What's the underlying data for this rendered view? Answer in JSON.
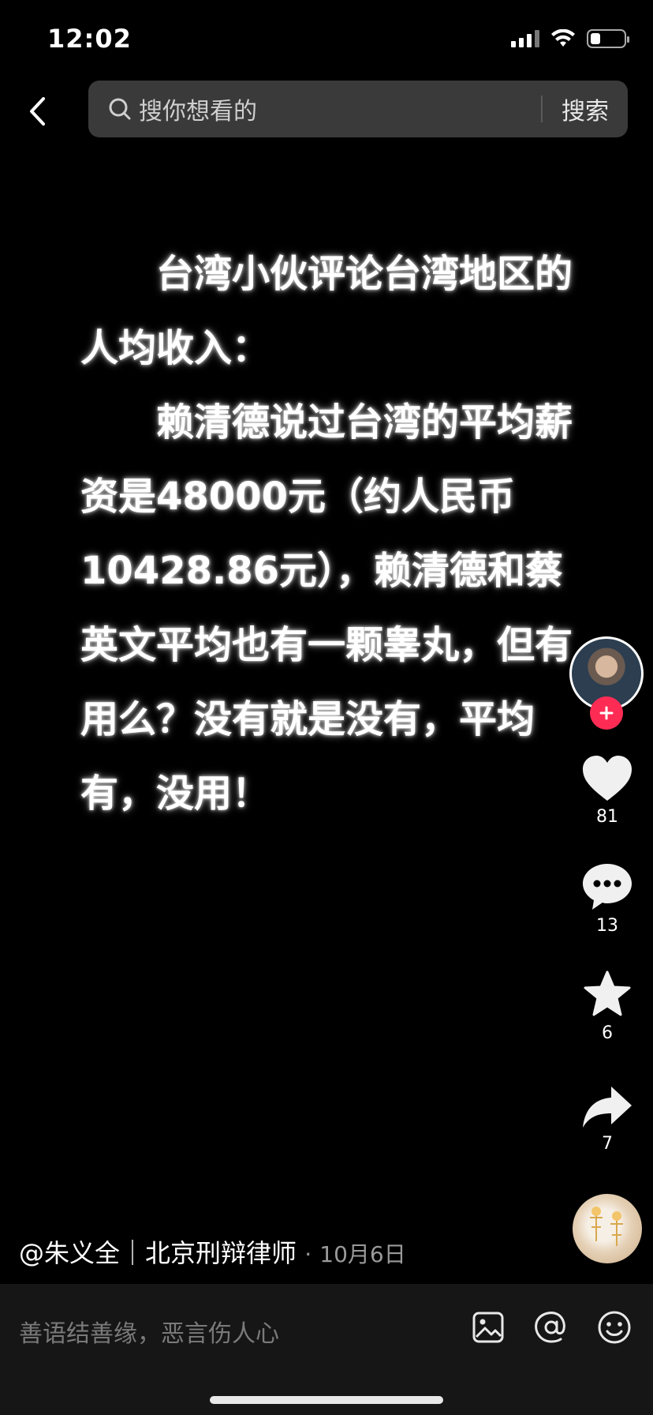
{
  "status_bar": {
    "time": "12:02",
    "battery_level": 0.3
  },
  "search": {
    "placeholder": "搜你想看的",
    "submit_label": "搜索"
  },
  "content": {
    "paragraphs": [
      "台湾小伙评论台湾地区的人均收入：",
      "赖清德说过台湾的平均薪资是48000元（约人民币10428.86元），赖清德和蔡英文平均也有一颗睾丸，但有用么？没有就是没有，平均有，没用！"
    ]
  },
  "actions": {
    "likes": "81",
    "comments": "13",
    "favorites": "6",
    "shares": "7"
  },
  "author": {
    "handle": "@朱义全｜北京刑辩律师",
    "separator": "·",
    "date": "10月6日"
  },
  "comment_bar": {
    "placeholder": "善语结善缘，恶言伤人心"
  },
  "colors": {
    "follow": "#fe2c55",
    "background": "#000000",
    "search_bg": "#3a3a3a"
  },
  "icons": [
    "chevron-left-icon",
    "search-icon",
    "heart-icon",
    "comment-icon",
    "star-icon",
    "share-icon",
    "image-icon",
    "at-icon",
    "emoji-icon"
  ]
}
